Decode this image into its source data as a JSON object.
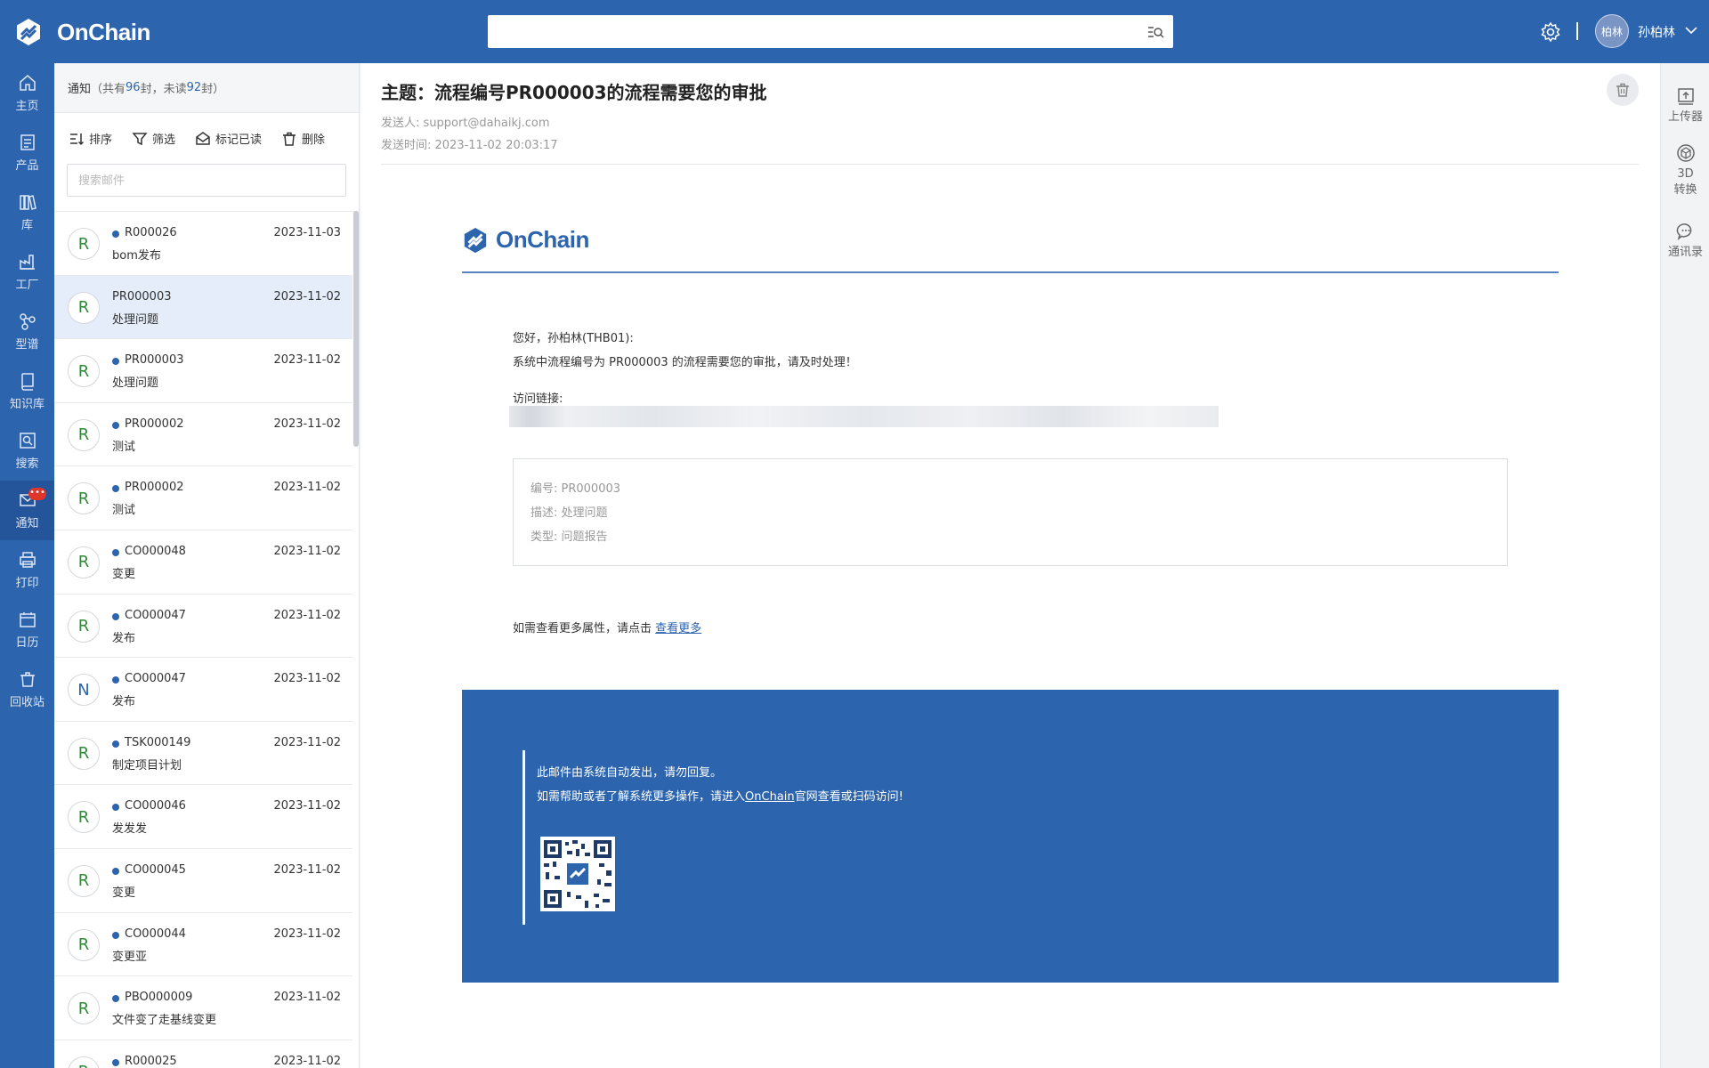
{
  "app": {
    "name": "OnChain"
  },
  "header": {
    "search_value": "",
    "username": "孙柏林",
    "avatar_text": "柏林"
  },
  "nav": [
    {
      "label": "主页",
      "icon": "home-icon"
    },
    {
      "label": "产品",
      "icon": "product-icon"
    },
    {
      "label": "库",
      "icon": "library-icon"
    },
    {
      "label": "工厂",
      "icon": "factory-icon"
    },
    {
      "label": "型谱",
      "icon": "spectrum-icon"
    },
    {
      "label": "知识库",
      "icon": "knowledge-icon"
    },
    {
      "label": "搜索",
      "icon": "search-icon"
    },
    {
      "label": "通知",
      "icon": "mail-icon",
      "badge": "•••"
    },
    {
      "label": "打印",
      "icon": "printer-icon"
    },
    {
      "label": "日历",
      "icon": "calendar-icon"
    },
    {
      "label": "回收站",
      "icon": "recycle-bin-icon"
    }
  ],
  "list": {
    "title": "通知",
    "prefix": "（共有 ",
    "total": "96",
    "mid": " 封，未读 ",
    "unread": "92",
    "suffix": " 封）",
    "toolbar": {
      "sort": "排序",
      "filter": "筛选",
      "mark_read": "标记已读",
      "delete": "删除"
    },
    "search_placeholder": "搜索邮件",
    "items": [
      {
        "avatar": "R",
        "id": "R000026",
        "date": "2023-11-03",
        "subject": "bom发布",
        "unread": true
      },
      {
        "avatar": "R",
        "id": "PR000003",
        "date": "2023-11-02",
        "subject": "处理问题",
        "unread": false
      },
      {
        "avatar": "R",
        "id": "PR000003",
        "date": "2023-11-02",
        "subject": "处理问题",
        "unread": true
      },
      {
        "avatar": "R",
        "id": "PR000002",
        "date": "2023-11-02",
        "subject": "测试",
        "unread": true
      },
      {
        "avatar": "R",
        "id": "PR000002",
        "date": "2023-11-02",
        "subject": "测试",
        "unread": true
      },
      {
        "avatar": "R",
        "id": "CO000048",
        "date": "2023-11-02",
        "subject": "变更",
        "unread": true
      },
      {
        "avatar": "R",
        "id": "CO000047",
        "date": "2023-11-02",
        "subject": "发布",
        "unread": true
      },
      {
        "avatar": "N",
        "id": "CO000047",
        "date": "2023-11-02",
        "subject": "发布",
        "unread": true
      },
      {
        "avatar": "R",
        "id": "TSK000149",
        "date": "2023-11-02",
        "subject": "制定项目计划",
        "unread": true
      },
      {
        "avatar": "R",
        "id": "CO000046",
        "date": "2023-11-02",
        "subject": "发发发",
        "unread": true
      },
      {
        "avatar": "R",
        "id": "CO000045",
        "date": "2023-11-02",
        "subject": "变更",
        "unread": true
      },
      {
        "avatar": "R",
        "id": "CO000044",
        "date": "2023-11-02",
        "subject": "变更亚",
        "unread": true
      },
      {
        "avatar": "R",
        "id": "PBO000009",
        "date": "2023-11-02",
        "subject": "文件变了走基线变更",
        "unread": true
      },
      {
        "avatar": "R",
        "id": "R000025",
        "date": "2023-11-02",
        "subject": "",
        "unread": true
      }
    ]
  },
  "mail": {
    "subject": "主题：流程编号PR000003的流程需要您的审批",
    "sender": "发送人: support@dahaikj.com",
    "sent_time": "发送时间: 2023-11-02 20:03:17",
    "logo_text": "OnChain",
    "greeting": "您好，孙柏林(THB01):",
    "body_line": "系统中流程编号为 PR000003 的流程需要您的审批，请及时处理！",
    "link_label": "访问链接:",
    "info": [
      {
        "text": "编号:  PR000003"
      },
      {
        "text": "描述:  处理问题"
      },
      {
        "text": "类型:  问题报告"
      }
    ],
    "more_prefix": "如需查看更多属性，请点击 ",
    "more_link": "查看更多",
    "footer_line1": "此邮件由系统自动发出，请勿回复。",
    "footer_line2_prefix": "如需帮助或者了解系统更多操作，请进入",
    "footer_line2_link": "OnChain",
    "footer_line2_suffix": "官网查看或扫码访问!"
  },
  "right_rail": [
    {
      "label": "上传器",
      "icon": "upload-icon"
    },
    {
      "label": "3D\n转换",
      "icon": "cube-icon"
    },
    {
      "label": "通讯录",
      "icon": "chat-icon"
    }
  ],
  "colors": {
    "brand": "#2c64ae",
    "selected_row": "#e4edf9",
    "badge": "#e0352b"
  }
}
